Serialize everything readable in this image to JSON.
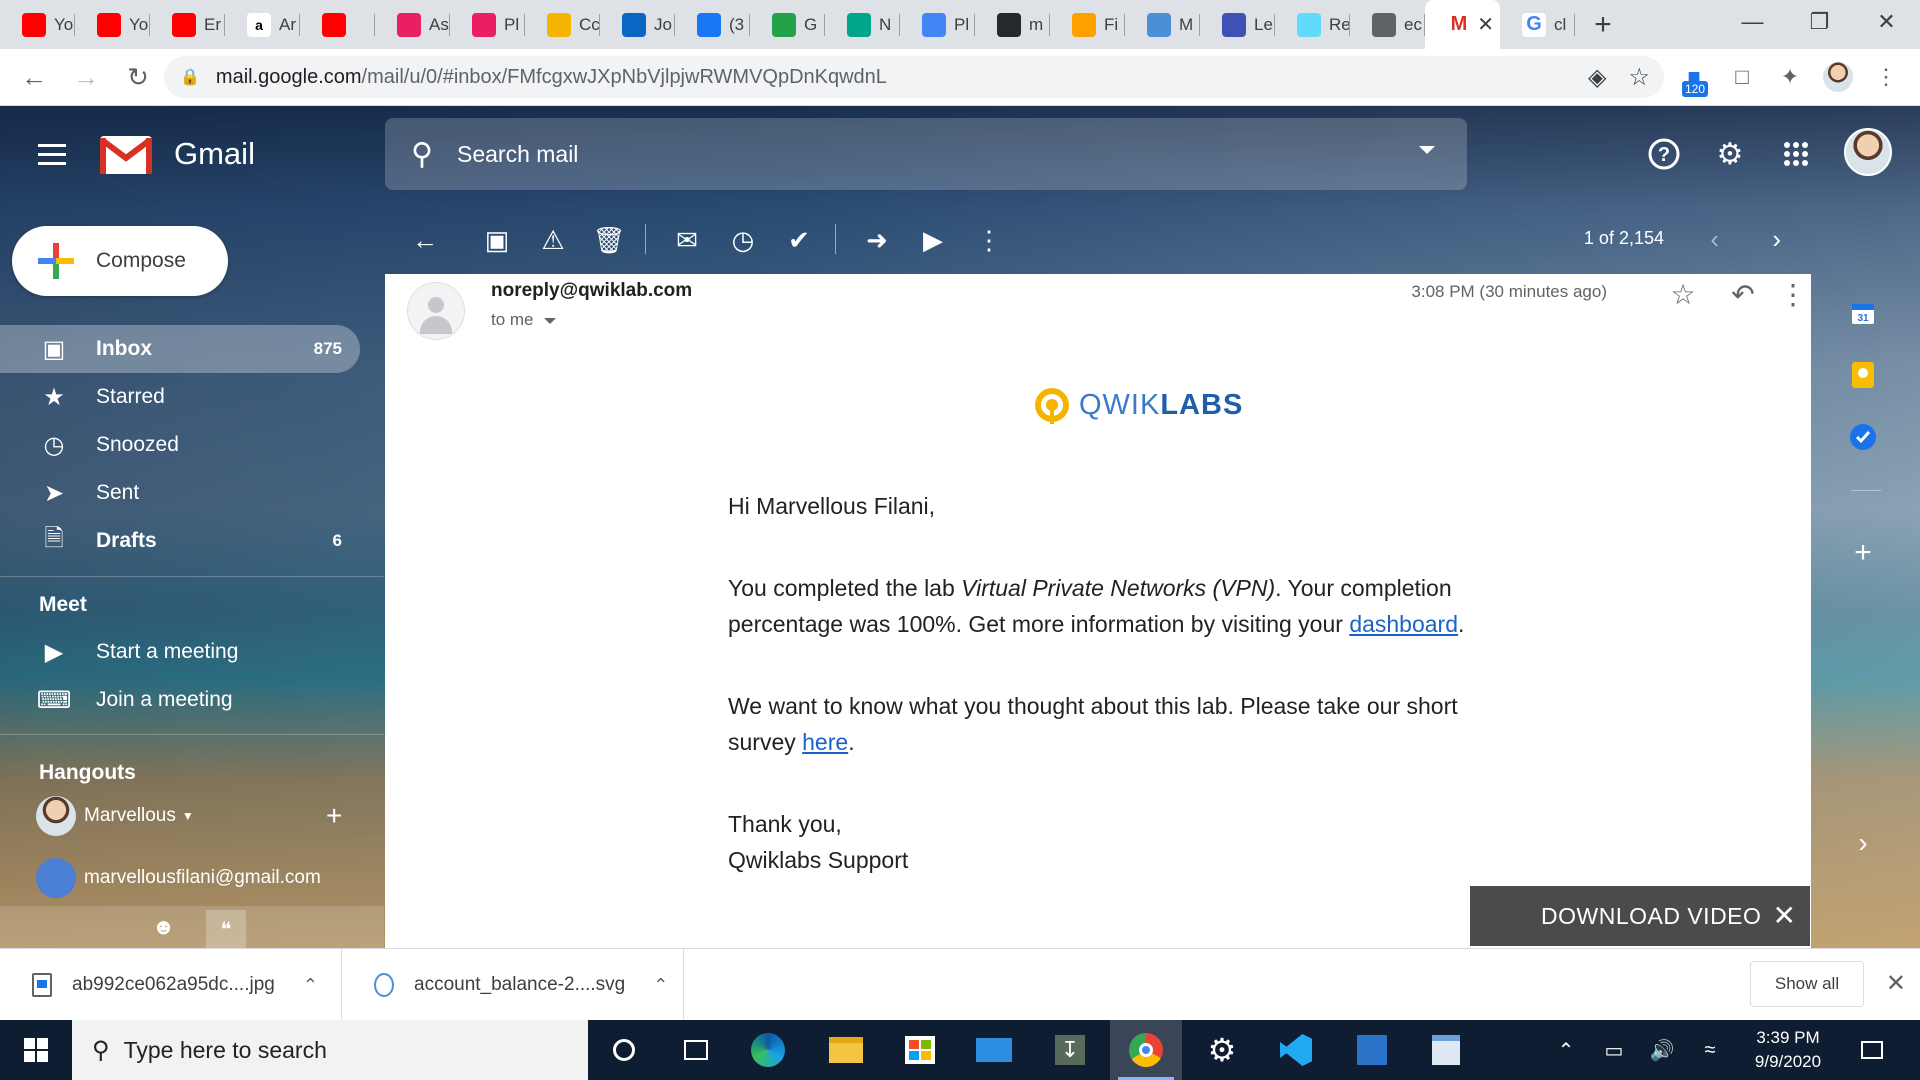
{
  "browser": {
    "tabs": [
      {
        "title": "Yo",
        "icon": "youtube-icon",
        "color": "#ff0000"
      },
      {
        "title": "Yo",
        "icon": "youtube-icon",
        "color": "#ff0000"
      },
      {
        "title": "Er",
        "icon": "youtube-icon",
        "color": "#ff0000"
      },
      {
        "title": "Ar",
        "icon": "amazon-icon",
        "color": "#ffffff"
      },
      {
        "title": "",
        "icon": "youtube-icon",
        "color": "#ff0000"
      },
      {
        "title": "As",
        "icon": "play-icon",
        "color": "#e91e63"
      },
      {
        "title": "Pl",
        "icon": "play-icon",
        "color": "#e91e63"
      },
      {
        "title": "Cc",
        "icon": "qwiklabs-icon",
        "color": "#f5b400"
      },
      {
        "title": "Jo",
        "icon": "linkedin-icon",
        "color": "#0a66c2"
      },
      {
        "title": "(3",
        "icon": "facebook-icon",
        "color": "#1877f2"
      },
      {
        "title": "G",
        "icon": "tradingview-icon",
        "color": "#22a34a"
      },
      {
        "title": "N",
        "icon": "diamond-icon",
        "color": "#00a58a"
      },
      {
        "title": "Pl",
        "icon": "pinwheel-icon",
        "color": "#4285f4"
      },
      {
        "title": "m",
        "icon": "github-icon",
        "color": "#24292e"
      },
      {
        "title": "Fi",
        "icon": "firebase-icon",
        "color": "#ffa000"
      },
      {
        "title": "M",
        "icon": "logo-icon",
        "color": "#4a90d9"
      },
      {
        "title": "Le",
        "icon": "gear-icon",
        "color": "#3f51b5"
      },
      {
        "title": "Re",
        "icon": "react-icon",
        "color": "#61dafb"
      },
      {
        "title": "ec",
        "icon": "globe-icon",
        "color": "#5f6368"
      }
    ],
    "active_tab": {
      "title": "",
      "icon": "gmail-icon"
    },
    "last_tab": {
      "title": "cl",
      "icon": "google-icon"
    },
    "url_host": "mail.google.com",
    "url_path": "/mail/u/0/#inbox/FMfcgxwJXpNbVjlpjwRWMVQpDnKqwdnL",
    "extension_badge": "120"
  },
  "gmail": {
    "brand": "Gmail",
    "search_placeholder": "Search mail",
    "compose_label": "Compose",
    "nav": [
      {
        "label": "Inbox",
        "count": "875",
        "icon": "inbox-icon",
        "selected": true
      },
      {
        "label": "Starred",
        "count": "",
        "icon": "star-icon"
      },
      {
        "label": "Snoozed",
        "count": "",
        "icon": "clock-icon"
      },
      {
        "label": "Sent",
        "count": "",
        "icon": "send-icon"
      },
      {
        "label": "Drafts",
        "count": "6",
        "icon": "draft-icon"
      }
    ],
    "meet": {
      "title": "Meet",
      "items": [
        {
          "label": "Start a meeting",
          "icon": "video-icon"
        },
        {
          "label": "Join a meeting",
          "icon": "keyboard-icon"
        }
      ]
    },
    "hangouts": {
      "title": "Hangouts",
      "user": "Marvellous",
      "contact": "marvellousfilani@gmail.com"
    },
    "pager": "1 of 2,154"
  },
  "message": {
    "sender": "noreply@qwiklab.com",
    "to": "to me",
    "time": "3:08 PM (30 minutes ago)",
    "logo_text_light": "QWIK",
    "logo_text_bold": "LABS",
    "greeting": "Hi Marvellous Filani,",
    "p1_a": "You completed the lab ",
    "p1_lab": "Virtual Private Networks (VPN)",
    "p1_b": ". Your completion percentage was 100%. Get more information by visiting your ",
    "p1_link": "dashboard",
    "p1_c": ".",
    "p2_a": "We want to know what you thought about this lab. Please take our short survey ",
    "p2_link": "here",
    "p2_b": ".",
    "signoff": "Thank you,",
    "signature": "Qwiklabs Support",
    "download_video": "DOWNLOAD VIDEO"
  },
  "downloads": {
    "items": [
      {
        "name": "ab992ce062a95dc....jpg"
      },
      {
        "name": "account_balance-2....svg"
      }
    ],
    "show_all": "Show all"
  },
  "taskbar": {
    "search_placeholder": "Type here to search",
    "time": "3:39 PM",
    "date": "9/9/2020"
  }
}
